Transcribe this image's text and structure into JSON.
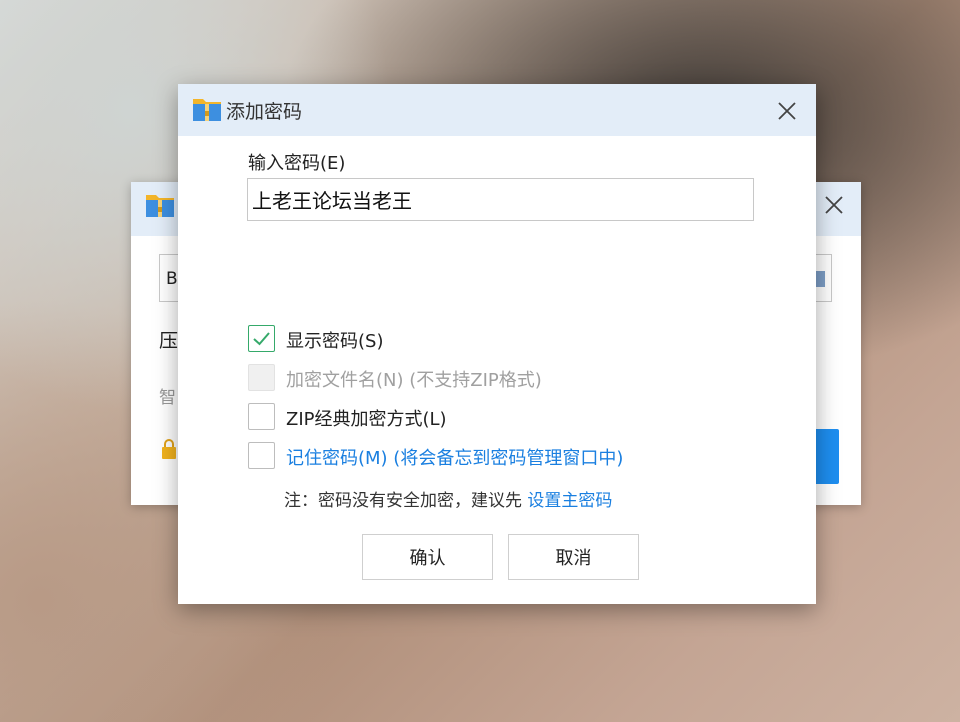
{
  "background_window": {
    "path_text": "B",
    "label_compress": "压",
    "label_smart": "智"
  },
  "dialog": {
    "title": "添加密码",
    "password_label": "输入密码(E)",
    "password_value": "上老王论坛当老王",
    "options": [
      {
        "label": "显示密码(S)",
        "checked": true,
        "disabled": false
      },
      {
        "label": "加密文件名(N) (不支持ZIP格式)",
        "checked": false,
        "disabled": true
      },
      {
        "label": "ZIP经典加密方式(L)",
        "checked": false,
        "disabled": false
      },
      {
        "label": "记住密码(M) (将会备忘到密码管理窗口中)",
        "checked": false,
        "disabled": false
      }
    ],
    "note_text": "注：密码没有安全加密，建议先 ",
    "note_link": "设置主密码",
    "ok_label": "确认",
    "cancel_label": "取消"
  },
  "colors": {
    "titlebar": "#e3edf8",
    "accent_link": "#1a7fe0",
    "check_green": "#35a96a",
    "primary_blue": "#1e8ef0"
  },
  "icons": [
    "folder-zip-icon",
    "close-icon",
    "checkmark-icon",
    "lock-icon"
  ]
}
